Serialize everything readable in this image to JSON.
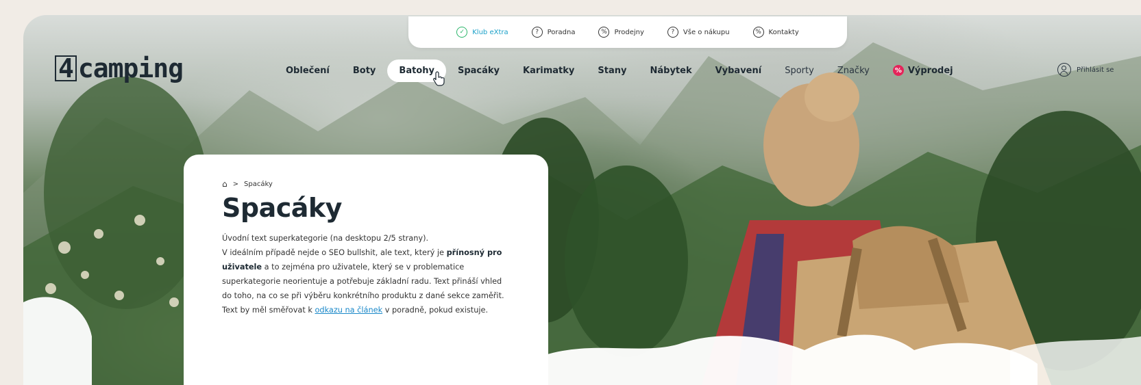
{
  "topbar": {
    "items": [
      {
        "label": "Klub eXtra",
        "icon": "klub-icon"
      },
      {
        "label": "Poradna",
        "icon": "question-icon"
      },
      {
        "label": "Prodejny",
        "icon": "store-icon"
      },
      {
        "label": "Vše o nákupu",
        "icon": "question-icon"
      },
      {
        "label": "Kontakty",
        "icon": "contact-icon"
      }
    ]
  },
  "header": {
    "logo_prefix": "4",
    "logo_text": "camping",
    "nav": [
      {
        "label": "Oblečení"
      },
      {
        "label": "Boty"
      },
      {
        "label": "Batohy"
      },
      {
        "label": "Spacáky"
      },
      {
        "label": "Karimatky"
      },
      {
        "label": "Stany"
      },
      {
        "label": "Nábytek"
      },
      {
        "label": "Vybavení"
      },
      {
        "label": "Sporty"
      },
      {
        "label": "Značky"
      },
      {
        "label": "Výprodej"
      }
    ],
    "login_label": "Přihlásit se"
  },
  "card": {
    "breadcrumb_separator": ">",
    "breadcrumb_current": "Spacáky",
    "title": "Spacáky",
    "intro_p1": "Úvodní text superkategorie (na desktopu 2/5 strany).",
    "intro_p2_a": "V ideálním případě nejde o SEO bullshit, ale text, který je ",
    "intro_bold": "přínosný pro uživatele",
    "intro_p2_b": " a to zejména pro uživatele, který se v problematice superkategorie neorientuje a potřebuje základní radu. Text přináší vhled do toho, na co se při výběru konkrétního produktu z dané sekce zaměřit. Text by měl směřovat k ",
    "intro_link": "odkazu na článek",
    "intro_p2_c": " v poradně, pokud existuje."
  },
  "colors": {
    "link": "#1a88c9",
    "sale": "#e5245a",
    "klub": "#2bb56a",
    "text_dark": "#1e2a33"
  }
}
